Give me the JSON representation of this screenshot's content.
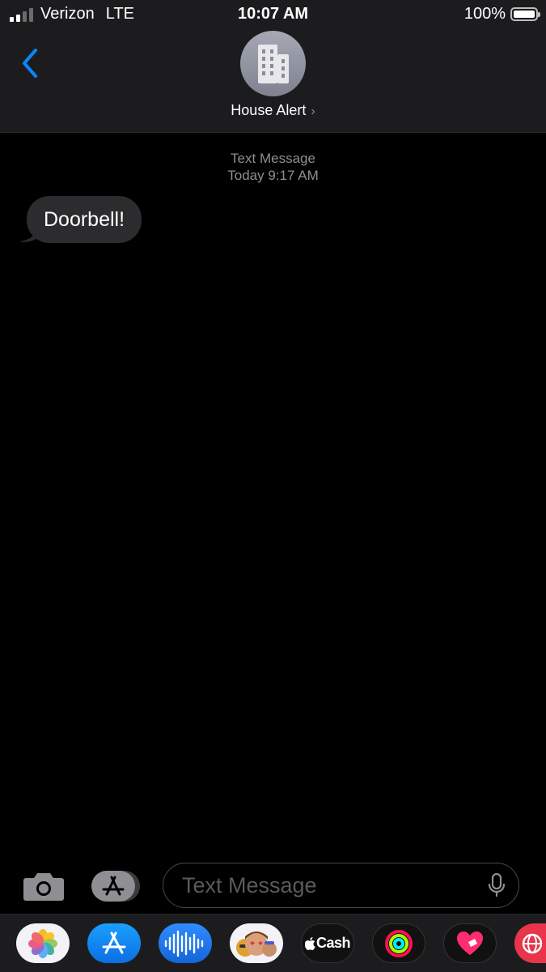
{
  "status_bar": {
    "carrier": "Verizon",
    "network": "LTE",
    "time": "10:07 AM",
    "battery_percent": "100%",
    "signal_bars": 2,
    "signal_bars_total": 4
  },
  "header": {
    "back_icon": "chevron-left-icon",
    "contact_name": "House Alert",
    "contact_avatar_icon": "building-icon",
    "chevron": "›",
    "accent_color": "#0a84ff"
  },
  "conversation": {
    "service_label": "Text Message",
    "timestamp": "Today 9:17 AM",
    "messages": [
      {
        "direction": "incoming",
        "text": "Doorbell!"
      }
    ]
  },
  "input_bar": {
    "camera_icon": "camera-icon",
    "apps_icon": "app-store-icon",
    "placeholder": "Text Message",
    "value": "",
    "mic_icon": "microphone-icon"
  },
  "app_drawer": {
    "apps": [
      {
        "name": "Photos",
        "icon": "photos-icon"
      },
      {
        "name": "App Store",
        "icon": "app-store-icon"
      },
      {
        "name": "Audio Message",
        "icon": "audio-waveform-icon"
      },
      {
        "name": "Memoji",
        "icon": "memoji-icon"
      },
      {
        "name": "Apple Cash",
        "icon": "apple-cash-icon",
        "label": "Cash"
      },
      {
        "name": "Activity",
        "icon": "activity-rings-icon"
      },
      {
        "name": "Digital Touch",
        "icon": "heart-touch-icon"
      },
      {
        "name": "Images",
        "icon": "globe-search-icon"
      }
    ]
  }
}
